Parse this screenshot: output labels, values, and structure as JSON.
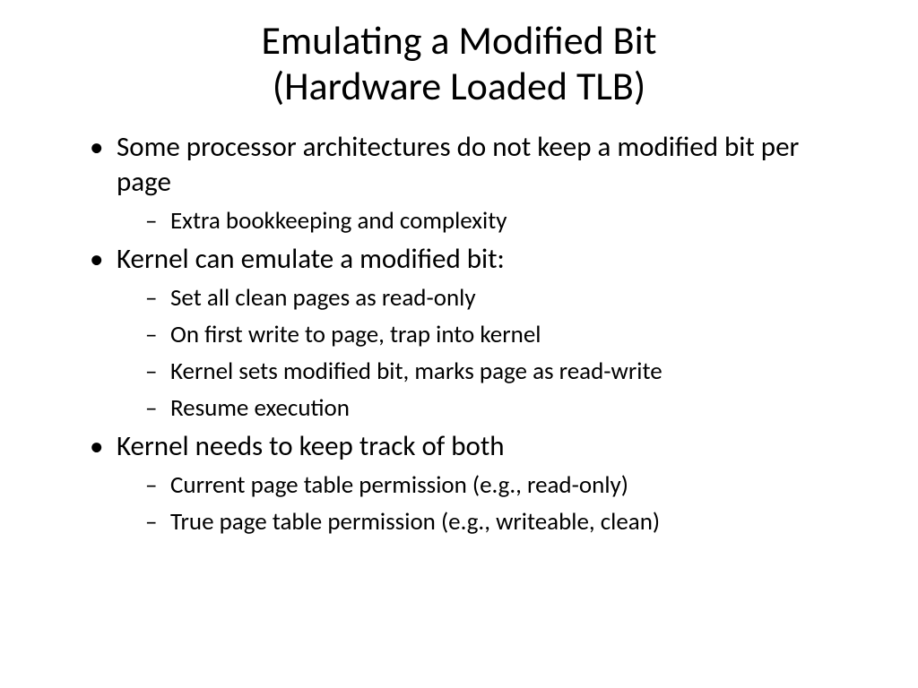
{
  "title_line1": "Emulating a Modified Bit",
  "title_line2": "(Hardware Loaded TLB)",
  "bullets": {
    "b1": "Some processor architectures do not keep a modified bit per page",
    "b1_sub1": "Extra bookkeeping and complexity",
    "b2": "Kernel can emulate a modified bit:",
    "b2_sub1": "Set all clean pages as read-only",
    "b2_sub2": "On first write to page, trap into kernel",
    "b2_sub3": "Kernel sets modified bit, marks page as read-write",
    "b2_sub4": "Resume execution",
    "b3": "Kernel needs to keep track of both",
    "b3_sub1": "Current page table permission (e.g., read-only)",
    "b3_sub2": "True page table permission (e.g., writeable, clean)"
  }
}
